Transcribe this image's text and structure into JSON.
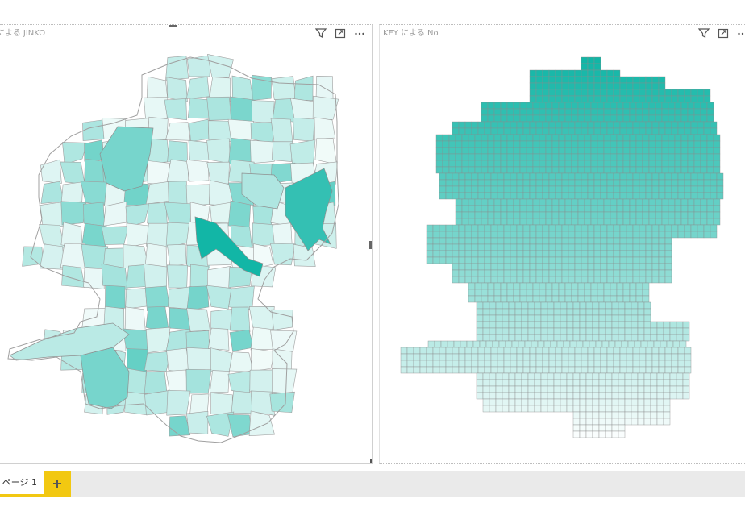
{
  "colors": {
    "accent": "#1ab8a8",
    "map_min": "#f2fbfa",
    "map_max": "#12b6a6",
    "tab_accent": "#f2c811",
    "grid_stroke": "#8c8c8c"
  },
  "left_visual": {
    "title": "による JINKO",
    "icons": [
      "filter-icon",
      "focus-mode-icon",
      "more-options-icon"
    ],
    "more_label": "..."
  },
  "right_visual": {
    "title": "KEY による No",
    "icons": [
      "filter-icon",
      "focus-mode-icon",
      "more-options-icon"
    ],
    "more_label": "..."
  },
  "tabs": {
    "page_label": "ページ 1",
    "add_label": "+"
  }
}
